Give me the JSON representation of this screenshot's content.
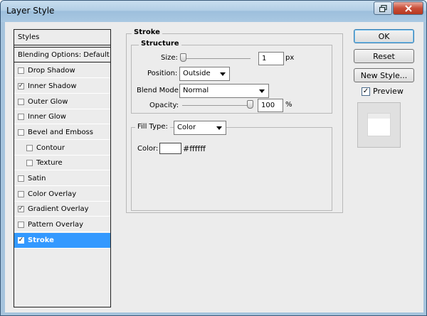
{
  "window": {
    "title": "Layer Style"
  },
  "sidebar": {
    "header": "Styles",
    "blending": "Blending Options: Default",
    "items": [
      {
        "label": "Drop Shadow",
        "checked": false
      },
      {
        "label": "Inner Shadow",
        "checked": true
      },
      {
        "label": "Outer Glow",
        "checked": false
      },
      {
        "label": "Inner Glow",
        "checked": false
      },
      {
        "label": "Bevel and Emboss",
        "checked": false
      },
      {
        "label": "Contour",
        "checked": false
      },
      {
        "label": "Texture",
        "checked": false
      },
      {
        "label": "Satin",
        "checked": false
      },
      {
        "label": "Color Overlay",
        "checked": false
      },
      {
        "label": "Gradient Overlay",
        "checked": true
      },
      {
        "label": "Pattern Overlay",
        "checked": false
      },
      {
        "label": "Stroke",
        "checked": true,
        "selected": true
      }
    ]
  },
  "stroke": {
    "title": "Stroke",
    "structure_title": "Structure",
    "size_label": "Size:",
    "size_value": "1",
    "size_unit": "px",
    "position_label": "Position:",
    "position_value": "Outside",
    "blend_label": "Blend Mode:",
    "blend_value": "Normal",
    "opacity_label": "Opacity:",
    "opacity_value": "100",
    "opacity_unit": "%",
    "fill_type_label": "Fill Type:",
    "fill_type_value": "Color",
    "color_label": "Color:",
    "color_value": "#ffffff"
  },
  "buttons": {
    "ok": "OK",
    "reset": "Reset",
    "new_style": "New Style...",
    "preview_label": "Preview",
    "preview_checked": true
  },
  "colors": {
    "selection": "#3399ff",
    "swatch": "#ffffff"
  }
}
